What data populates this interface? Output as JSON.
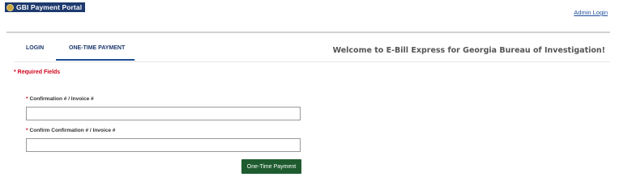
{
  "header": {
    "logo_text": "GBI Payment Portal",
    "admin_login": "Admin Login"
  },
  "tabs": [
    {
      "label": "LOGIN",
      "active": false
    },
    {
      "label": "ONE-TIME PAYMENT",
      "active": true
    }
  ],
  "welcome_text": "Welcome to E-Bill Express for Georgia Bureau of Investigation!",
  "form": {
    "required_note": "* Required Fields",
    "required_marker": "*",
    "fields": [
      {
        "label": "Confirmation # / Invoice #",
        "value": ""
      },
      {
        "label": "Confirm Confirmation # / Invoice #",
        "value": ""
      }
    ],
    "submit_label": "One-Time Payment"
  },
  "colors": {
    "brand_navy": "#1e3a6e",
    "link_blue": "#1f4e9e",
    "required_red": "#d0021b",
    "button_green": "#1e5c2f"
  }
}
